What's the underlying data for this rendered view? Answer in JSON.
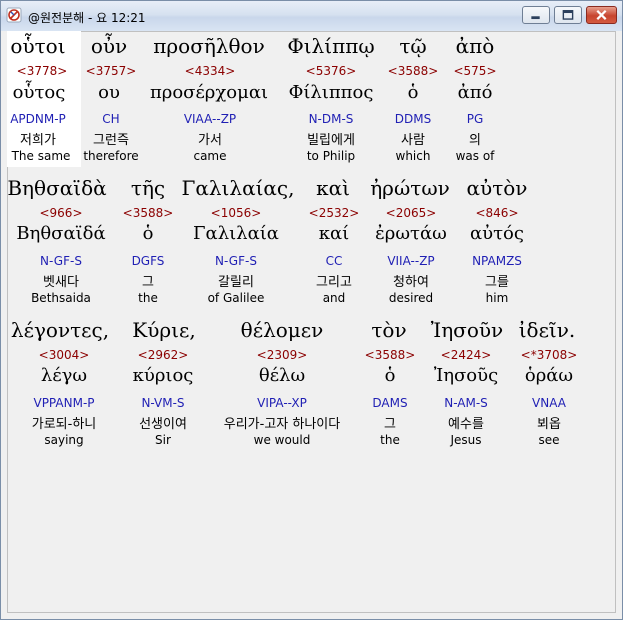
{
  "window": {
    "title": "@원전분해 - 요 12:21",
    "controls": [
      "minimize-icon",
      "maximize-icon",
      "close-icon"
    ],
    "colors": {
      "strong": "#8b0000",
      "parse": "#1f1fb4",
      "selection": "#ffffff"
    }
  },
  "rows": [
    {
      "words": [
        {
          "greek": "οὗτοι",
          "strong": "<3778>",
          "lemma": "οὗτος",
          "parse": "APDNM-P",
          "korean": "저희가",
          "english": "The same"
        },
        {
          "greek": "οὖν",
          "strong": "<3757>",
          "lemma": "ου",
          "parse": "CH",
          "korean": "그런즉",
          "english": "therefore"
        },
        {
          "greek": "προσῆλθον",
          "strong": "<4334>",
          "lemma": "προσέρχομαι",
          "parse": "VIAA--ZP",
          "korean": "가서",
          "english": "came"
        },
        {
          "greek": "Φιλίππῳ",
          "strong": "<5376>",
          "lemma": "Φίλιππος",
          "parse": "N-DM-S",
          "korean": "빌립에게",
          "english": "to Philip"
        },
        {
          "greek": "τῷ",
          "strong": "<3588>",
          "lemma": "ὁ",
          "parse": "DDMS",
          "korean": "사람",
          "english": "which"
        },
        {
          "greek": "ἀπὸ",
          "strong": "<575>",
          "lemma": "ἀπό",
          "parse": "PG",
          "korean": "의",
          "english": "was of"
        }
      ]
    },
    {
      "words": [
        {
          "greek": "Βηθσαϊδὰ",
          "strong": "<966>",
          "lemma": "Βηθσαϊδά",
          "parse": "N-GF-S",
          "korean": "벳새다",
          "english": "Bethsaida"
        },
        {
          "greek": "τῆς",
          "strong": "<3588>",
          "lemma": "ὁ",
          "parse": "DGFS",
          "korean": "그",
          "english": "the"
        },
        {
          "greek": "Γαλιλαίας,",
          "strong": "<1056>",
          "lemma": "Γαλιλαία",
          "parse": "N-GF-S",
          "korean": "갈릴리",
          "english": "of Galilee"
        },
        {
          "greek": "καὶ",
          "strong": "<2532>",
          "lemma": "καί",
          "parse": "CC",
          "korean": "그리고",
          "english": "and"
        },
        {
          "greek": "ἠρώτων",
          "strong": "<2065>",
          "lemma": "ἐρωτάω",
          "parse": "VIIA--ZP",
          "korean": "청하여",
          "english": "desired"
        },
        {
          "greek": "αὐτὸν",
          "strong": "<846>",
          "lemma": "αὐτός",
          "parse": "NPAMZS",
          "korean": "그를",
          "english": "him"
        }
      ]
    },
    {
      "words": [
        {
          "greek": "λέγοντες,",
          "strong": "<3004>",
          "lemma": "λέγω",
          "parse": "VPPANM-P",
          "korean": "가로되-하니",
          "english": "saying"
        },
        {
          "greek": "Κύριε,",
          "strong": "<2962>",
          "lemma": "κύριος",
          "parse": "N-VM-S",
          "korean": "선생이여",
          "english": "Sir"
        },
        {
          "greek": "θέλομεν",
          "strong": "<2309>",
          "lemma": "θέλω",
          "parse": "VIPA--XP",
          "korean": "우리가-고자 하나이다",
          "english": "we would"
        },
        {
          "greek": "τὸν",
          "strong": "<3588>",
          "lemma": "ὁ",
          "parse": "DAMS",
          "korean": "그",
          "english": "the"
        },
        {
          "greek": "Ἰησοῦν",
          "strong": "<2424>",
          "lemma": "Ἰησοῦς",
          "parse": "N-AM-S",
          "korean": "예수를",
          "english": "Jesus"
        },
        {
          "greek": "ἰδεῖν.",
          "strong": "<*3708>",
          "lemma": "ὁράω",
          "parse": "VNAA",
          "korean": "뵈옵",
          "english": "see"
        }
      ]
    }
  ]
}
